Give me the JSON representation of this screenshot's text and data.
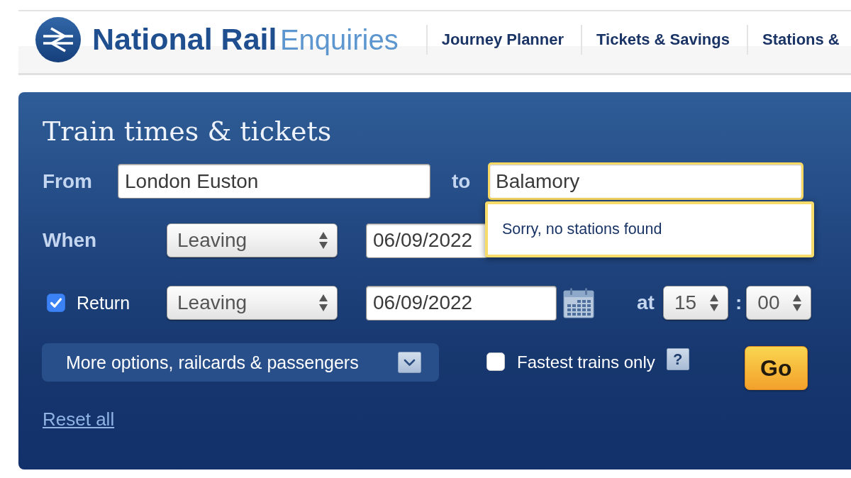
{
  "header": {
    "logo": {
      "name_bold": "National Rail",
      "name_light": "Enquiries"
    },
    "nav": [
      {
        "label": "Journey Planner"
      },
      {
        "label": "Tickets & Savings"
      },
      {
        "label": "Stations &"
      }
    ]
  },
  "search_panel": {
    "title": "Train times & tickets",
    "from": {
      "label": "From",
      "value": "London Euston"
    },
    "to": {
      "label": "to",
      "value": "Balamory",
      "focused": true,
      "suggestions_message": "Sorry, no stations found"
    },
    "when": {
      "label": "When",
      "mode": "Leaving",
      "date": "06/09/2022"
    },
    "return": {
      "label": "Return",
      "checked": true,
      "mode": "Leaving",
      "date": "06/09/2022",
      "time_label": "at",
      "hour": "15",
      "separator": ":",
      "minute": "00"
    },
    "more_options": {
      "label": "More options, railcards & passengers",
      "expanded": false
    },
    "fastest_only": {
      "label": "Fastest trains only",
      "checked": false
    },
    "help": "?",
    "go_button": "Go",
    "reset_link": "Reset all"
  }
}
